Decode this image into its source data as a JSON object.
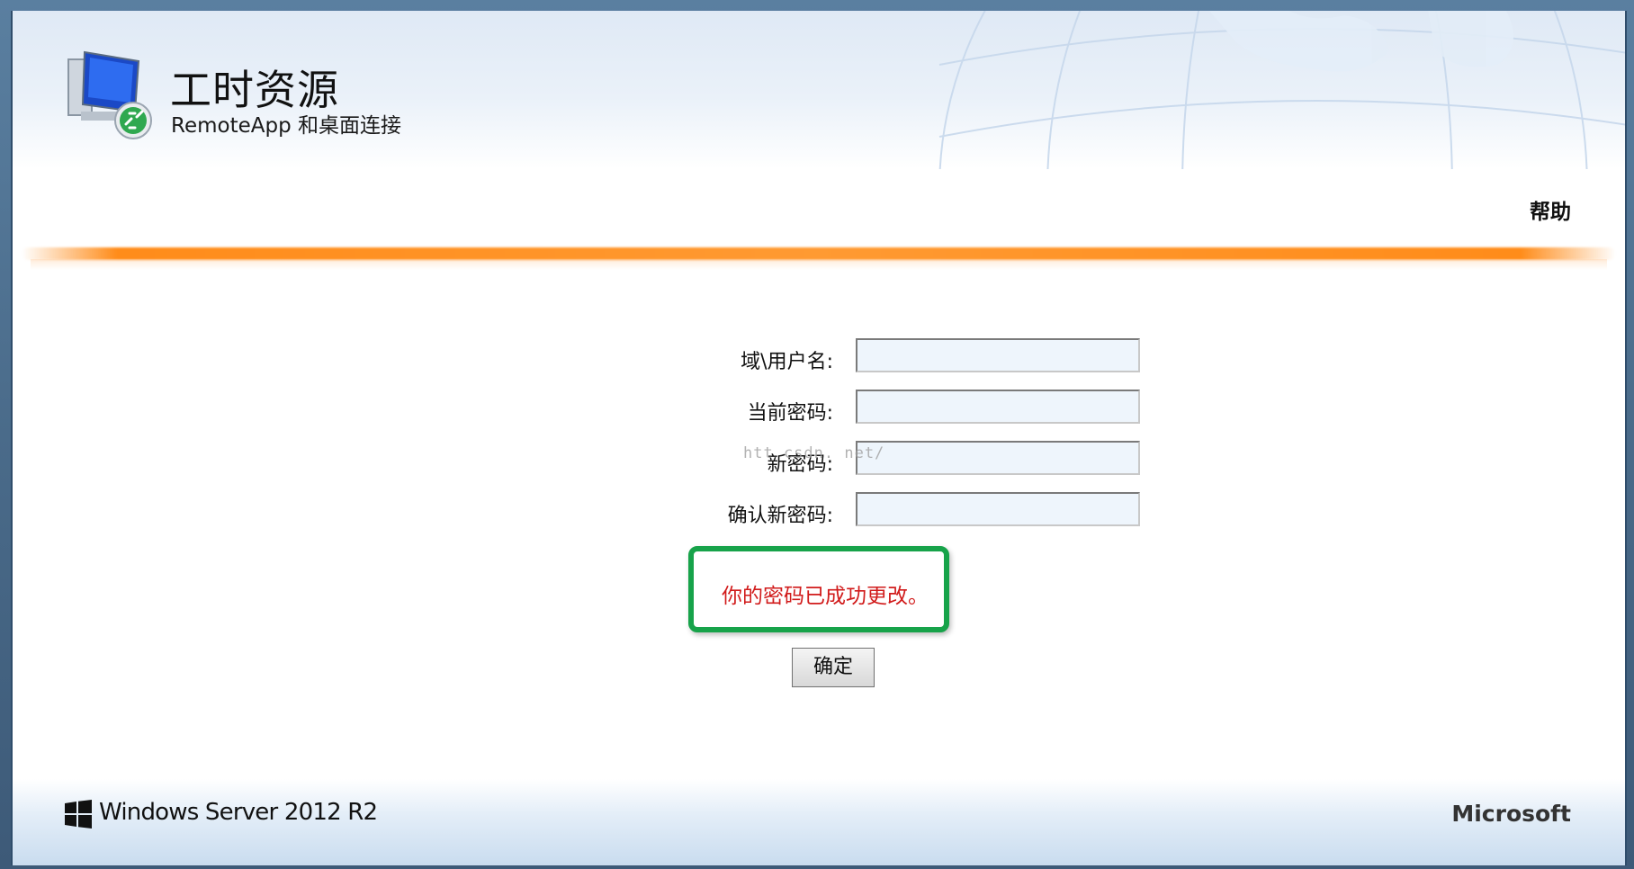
{
  "header": {
    "title": "工时资源",
    "subtitle": "RemoteApp 和桌面连接",
    "help_label": "帮助"
  },
  "form": {
    "fields": [
      {
        "label": "域\\用户名:",
        "value": ""
      },
      {
        "label": "当前密码:",
        "value": ""
      },
      {
        "label": "新密码:",
        "value": ""
      },
      {
        "label": "确认新密码:",
        "value": ""
      }
    ],
    "watermark": "htt              csdn. net/",
    "success_message": "你的密码已成功更改。",
    "ok_label": "确定"
  },
  "footer": {
    "product": "Windows Server 2012 R2",
    "brand": "Microsoft"
  },
  "colors": {
    "accent_orange": "#ff8c1a",
    "message_red": "#d11b1b",
    "highlight_green": "#17a34a",
    "input_bg": "#eef5fc"
  },
  "icons": [
    "remote-desktop-icon",
    "windows-logo-icon"
  ]
}
